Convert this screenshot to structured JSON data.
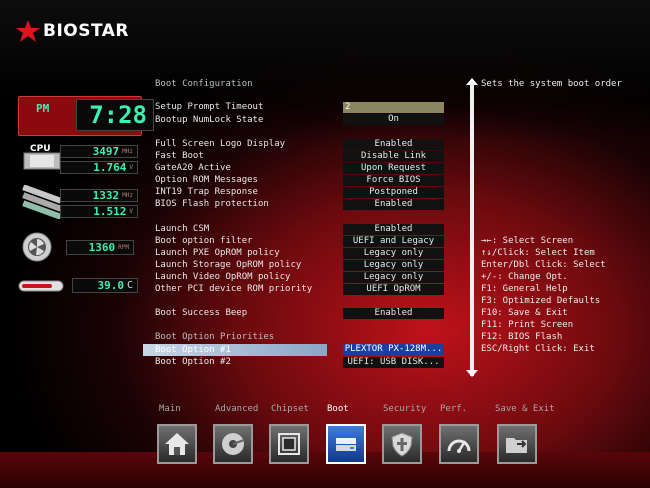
{
  "brand": {
    "name": "BIOSTAR"
  },
  "clock": {
    "ampm": "PM",
    "time": "7:28"
  },
  "cpu": {
    "label": "CPU",
    "freq": "3497",
    "freq_unit": "MHz",
    "voltage": "1.764",
    "volt_unit": "V"
  },
  "memory": {
    "freq": "1332",
    "freq_unit": "MHz",
    "voltage": "1.512",
    "volt_unit": "V"
  },
  "fan": {
    "rpm": "1360",
    "unit": "RPM"
  },
  "temp": {
    "value": "39.0",
    "unit": "C"
  },
  "menu": {
    "section_title": "Boot Configuration",
    "items": [
      {
        "label": "Setup Prompt Timeout",
        "value": "2"
      },
      {
        "label": "Bootup NumLock State",
        "value": "On"
      },
      {
        "label": "Full Screen Logo Display",
        "value": "Enabled"
      },
      {
        "label": "Fast Boot",
        "value": "Disable Link"
      },
      {
        "label": "GateA20 Active",
        "value": "Upon Request"
      },
      {
        "label": "Option ROM Messages",
        "value": "Force BIOS"
      },
      {
        "label": "INT19 Trap Response",
        "value": "Postponed"
      },
      {
        "label": "BIOS Flash protection",
        "value": "Enabled"
      },
      {
        "label": "Launch CSM",
        "value": "Enabled"
      },
      {
        "label": "Boot option filter",
        "value": "UEFI and Legacy"
      },
      {
        "label": "Launch PXE OpROM policy",
        "value": "Legacy only"
      },
      {
        "label": "Launch Storage OpROM policy",
        "value": "Legacy only"
      },
      {
        "label": "Launch Video OpROM policy",
        "value": "Legacy only"
      },
      {
        "label": "Other PCI device ROM priority",
        "value": "UEFI OpROM"
      },
      {
        "label": "Boot Success Beep",
        "value": "Enabled"
      }
    ],
    "priorities_title": "Boot Option Priorities",
    "boot_options": [
      {
        "label": "Boot Option #1",
        "value": "PLEXTOR PX-128M..."
      },
      {
        "label": "Boot Option #2",
        "value": "UEFI:  USB DISK..."
      }
    ]
  },
  "help": {
    "description": "Sets the system boot order",
    "keys": [
      "→←: Select Screen",
      "↑↓/Click: Select Item",
      "Enter/Dbl Click: Select",
      "+/-: Change Opt.",
      "F1: General Help",
      "F3: Optimized Defaults",
      "F10: Save & Exit",
      "F11: Print Screen",
      "F12: BIOS Flash",
      "ESC/Right Click: Exit"
    ]
  },
  "tabs": [
    {
      "label": "Main",
      "icon": "home-icon"
    },
    {
      "label": "Advanced",
      "icon": "disc-icon"
    },
    {
      "label": "Chipset",
      "icon": "chip-icon"
    },
    {
      "label": "Boot",
      "icon": "drive-icon",
      "active": true
    },
    {
      "label": "Security",
      "icon": "shield-icon"
    },
    {
      "label": "Perf.",
      "icon": "gauge-icon"
    },
    {
      "label": "Save & Exit",
      "icon": "folder-exit-icon"
    }
  ],
  "colors": {
    "accent_red": "#c0121a",
    "selected_blue": "#1b3fa0",
    "lcd_green": "#3cf0b0"
  }
}
